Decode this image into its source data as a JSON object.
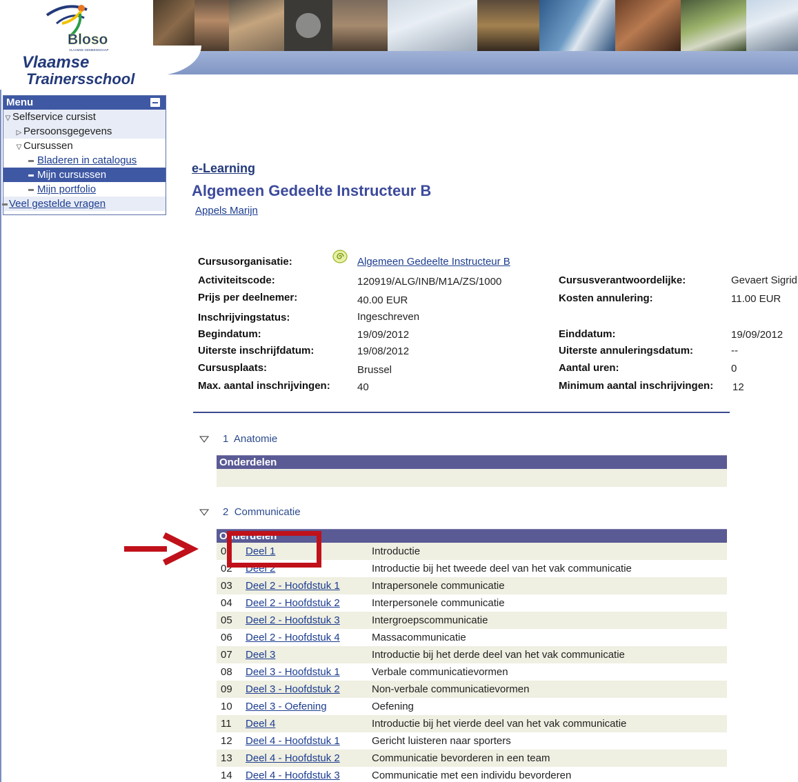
{
  "branding": {
    "logo_text": "Bloso",
    "logo_subtext": "VLAAMSE GEMEENSCHAP",
    "school_line1": "Vlaamse",
    "school_line2": "Trainersschool"
  },
  "menu": {
    "title": "Menu",
    "items": [
      {
        "label": "Selfservice cursist",
        "kind": "expanded"
      },
      {
        "label": "Persoonsgegevens",
        "kind": "collapsed"
      },
      {
        "label": "Cursussen",
        "kind": "expanded"
      },
      {
        "label": "Bladeren in catalogus",
        "kind": "link"
      },
      {
        "label": "Mijn cursussen",
        "kind": "active"
      },
      {
        "label": "Mijn portfolio",
        "kind": "link"
      },
      {
        "label": "Veel gestelde vragen",
        "kind": "link"
      }
    ]
  },
  "page": {
    "breadcrumb": "e-Learning",
    "title": "Algemeen Gedeelte Instructeur B",
    "user": "Appels Marijn"
  },
  "details": {
    "left": [
      {
        "label": "Cursusorganisatie:",
        "value": "Algemeen Gedeelte Instructeur B"
      },
      {
        "label": "Activiteitscode:",
        "value": "120919/ALG/INB/M1A/ZS/1000"
      },
      {
        "label": "Prijs per deelnemer:",
        "value": "40.00 EUR"
      },
      {
        "label": "Inschrijvingstatus:",
        "value": "Ingeschreven"
      },
      {
        "label": "Begindatum:",
        "value": "19/09/2012"
      },
      {
        "label": "Uiterste inschrijfdatum:",
        "value": "19/08/2012"
      },
      {
        "label": "Cursusplaats:",
        "value": "Brussel"
      },
      {
        "label": "Max. aantal inschrijvingen:",
        "value": "40"
      }
    ],
    "right": [
      {
        "label": "Cursusverantwoordelijke:",
        "value": "Gevaert Sigrid"
      },
      {
        "label": "Kosten annulering:",
        "value": "11.00 EUR"
      },
      {
        "label": "Einddatum:",
        "value": "19/09/2012"
      },
      {
        "label": "Uiterste annuleringsdatum:",
        "value": "--"
      },
      {
        "label": "Aantal uren:",
        "value": "0"
      },
      {
        "label": "Minimum aantal inschrijvingen:",
        "value": "12"
      }
    ]
  },
  "sections": [
    {
      "number": "1",
      "name": "Anatomie",
      "table_header": "Onderdelen",
      "rows": []
    },
    {
      "number": "2",
      "name": "Communicatie",
      "table_header": "Onderdelen",
      "rows": [
        {
          "num": "01",
          "part": "Deel 1",
          "desc": "Introductie"
        },
        {
          "num": "02",
          "part": "Deel 2",
          "desc": "Introductie bij het tweede deel van het vak communicatie"
        },
        {
          "num": "03",
          "part": "Deel 2 - Hoofdstuk 1",
          "desc": "Intrapersonele communicatie"
        },
        {
          "num": "04",
          "part": "Deel 2 - Hoofdstuk 2",
          "desc": "Interpersonele communicatie"
        },
        {
          "num": "05",
          "part": "Deel 2 - Hoofdstuk 3",
          "desc": "Intergroepscommunicatie"
        },
        {
          "num": "06",
          "part": "Deel 2 - Hoofdstuk 4",
          "desc": "Massacommunicatie"
        },
        {
          "num": "07",
          "part": "Deel 3",
          "desc": "Introductie bij het derde deel van het vak communicatie"
        },
        {
          "num": "08",
          "part": "Deel 3 - Hoofdstuk 1",
          "desc": "Verbale communicatievormen"
        },
        {
          "num": "09",
          "part": "Deel 3 - Hoofdstuk 2",
          "desc": "Non-verbale communicatievormen"
        },
        {
          "num": "10",
          "part": "Deel 3 - Oefening",
          "desc": "Oefening"
        },
        {
          "num": "11",
          "part": "Deel 4",
          "desc": "Introductie bij het vierde deel van het vak communicatie"
        },
        {
          "num": "12",
          "part": "Deel 4 - Hoofdstuk 1",
          "desc": "Gericht luisteren naar sporters"
        },
        {
          "num": "13",
          "part": "Deel 4 - Hoofdstuk 2",
          "desc": "Communicatie bevorderen in een team"
        },
        {
          "num": "14",
          "part": "Deel 4 - Hoofdstuk 3",
          "desc": "Communicatie met een individu bevorderen"
        }
      ]
    }
  ],
  "colors": {
    "menu_header": "#3e58a4",
    "table_header": "#5a5a95",
    "link": "#1c3d8f",
    "annotation_red": "#c0111a",
    "title": "#3c4a9b"
  },
  "icons": {
    "org": "spiral-icon",
    "annotation": "arrow-right-icon"
  }
}
